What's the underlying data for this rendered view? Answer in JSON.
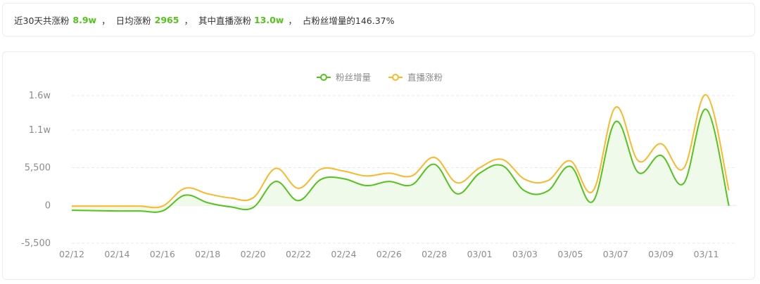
{
  "summary": {
    "prefix": "近30天共涨粉",
    "total_gain": "8.9w",
    "sep1": "，",
    "daily_label": "日均涨粉",
    "daily_avg": "2965",
    "sep2": "，",
    "live_label": "其中直播涨粉",
    "live_gain": "13.0w",
    "sep3": "，",
    "ratio_text": "占粉丝增量的146.37%"
  },
  "colors": {
    "fans": "#52c41a",
    "live": "#fbb829",
    "area": "#eef9e8",
    "grid": "#e9e9e9",
    "axis_text": "#8c8c8c"
  },
  "chart_data": {
    "type": "line",
    "legend": [
      "粉丝增量",
      "直播涨粉"
    ],
    "legend_position": "top-center",
    "y_ticks": [
      -5500,
      0,
      5500,
      11000,
      16000
    ],
    "y_tick_labels": [
      "-5,500",
      "0",
      "5,500",
      "1.1w",
      "1.6w"
    ],
    "ylim": [
      -5500,
      16000
    ],
    "x_tick_labels": [
      "02/12",
      "02/14",
      "02/16",
      "02/18",
      "02/20",
      "02/22",
      "02/24",
      "02/26",
      "02/28",
      "03/01",
      "03/03",
      "03/05",
      "03/07",
      "03/09",
      "03/11"
    ],
    "x_tick_index": [
      0,
      2,
      4,
      6,
      8,
      10,
      12,
      14,
      16,
      18,
      20,
      22,
      24,
      26,
      28
    ],
    "categories": [
      "02/12",
      "02/13",
      "02/14",
      "02/15",
      "02/16",
      "02/17",
      "02/18",
      "02/19",
      "02/20",
      "02/21",
      "02/22",
      "02/23",
      "02/24",
      "02/25",
      "02/26",
      "02/27",
      "02/28",
      "02/29",
      "03/01",
      "03/02",
      "03/03",
      "03/04",
      "03/05",
      "03/06",
      "03/07",
      "03/08",
      "03/09",
      "03/10",
      "03/11",
      "03/12"
    ],
    "series": [
      {
        "name": "粉丝增量",
        "area": true,
        "values": [
          -700,
          -750,
          -800,
          -800,
          -800,
          1500,
          400,
          -200,
          -300,
          3500,
          700,
          3800,
          3900,
          2900,
          3500,
          3000,
          6000,
          1700,
          4700,
          5800,
          2100,
          2100,
          5700,
          600,
          12200,
          4800,
          7300,
          3200,
          14000,
          -50
        ]
      },
      {
        "name": "直播涨粉",
        "area": false,
        "values": [
          -100,
          -100,
          -100,
          -100,
          -100,
          2500,
          1700,
          1100,
          1100,
          5400,
          2500,
          5300,
          5000,
          4300,
          4700,
          4300,
          7000,
          3300,
          5500,
          6700,
          3800,
          3600,
          6500,
          2100,
          14300,
          6500,
          9000,
          5400,
          16100,
          2200
        ]
      }
    ]
  }
}
